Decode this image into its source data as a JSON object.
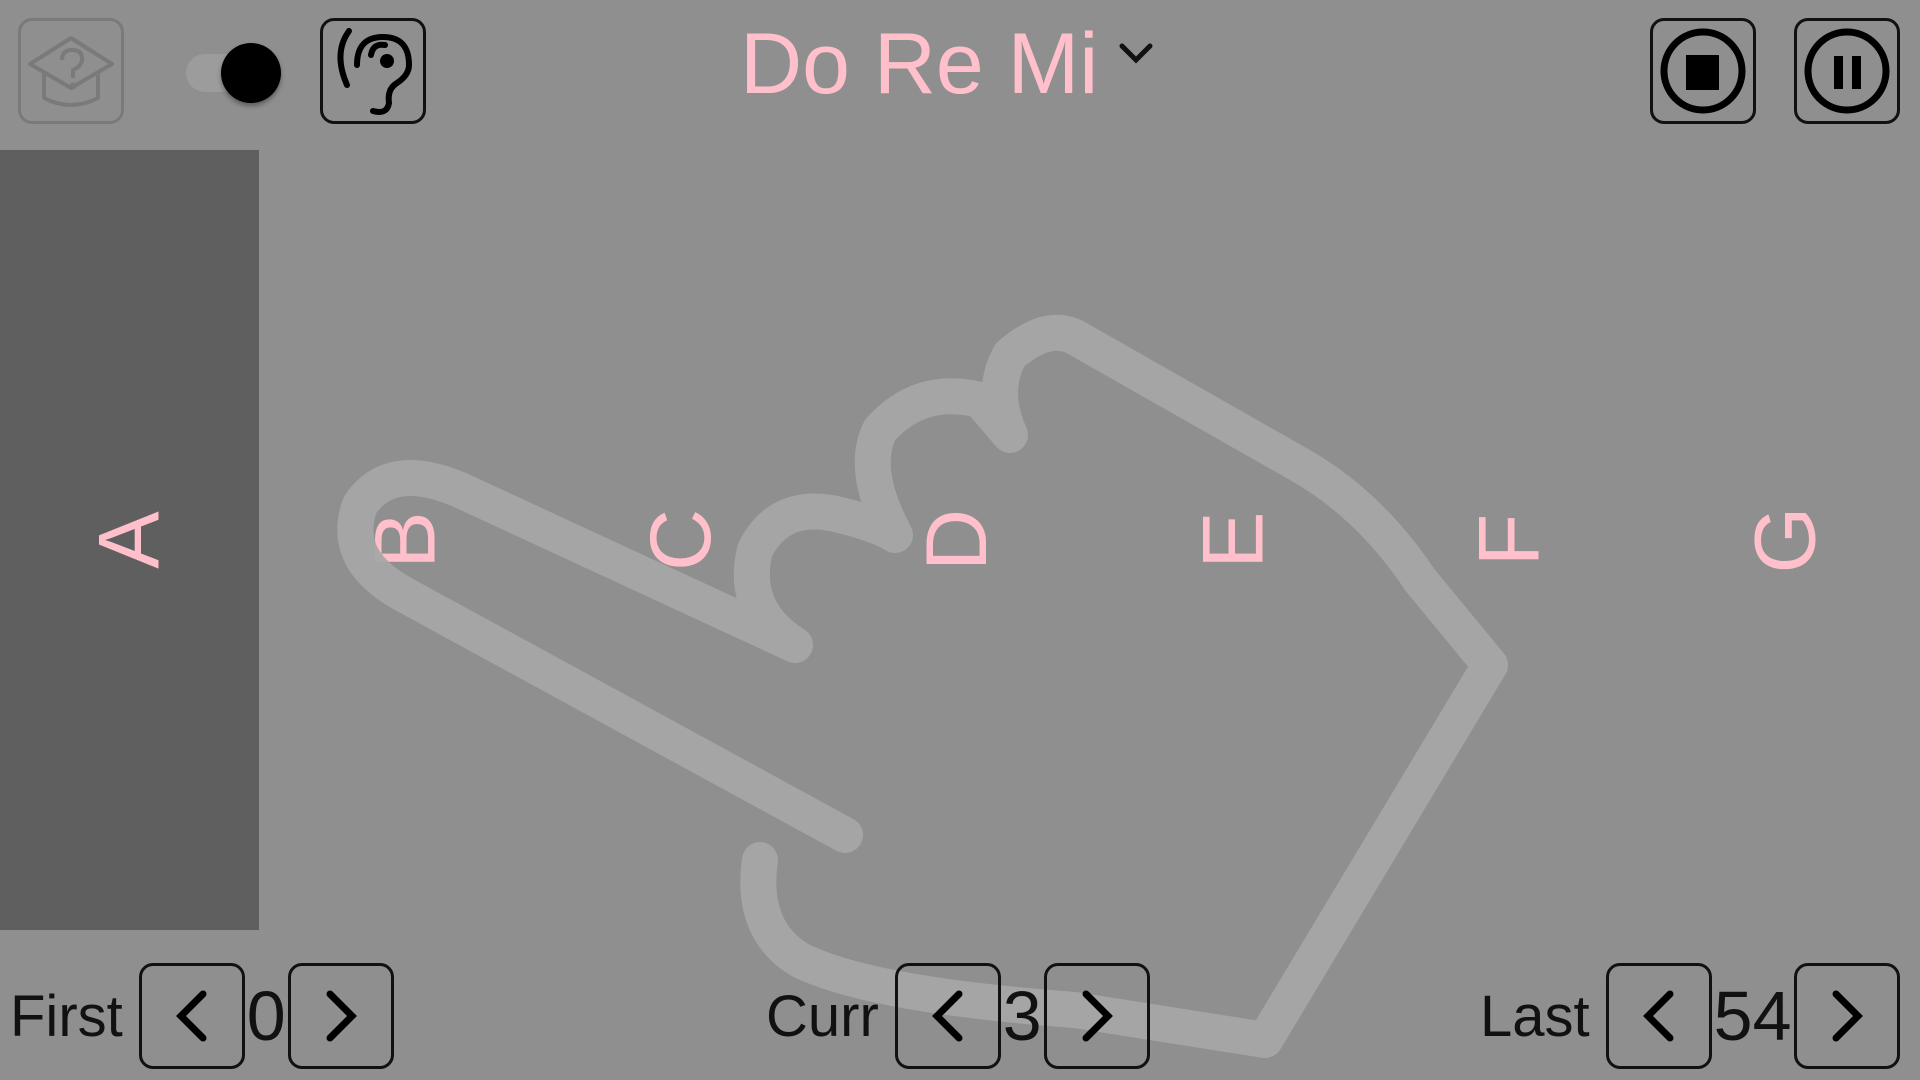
{
  "header": {
    "title": "Do Re Mi",
    "title_color": "#ffc0cb",
    "icons": {
      "help": "graduation-cap-question-icon",
      "toggle": "toggle-switch",
      "listen": "ear-icon",
      "stop": "stop-circle-icon",
      "pause": "pause-circle-icon",
      "dropdown": "chevron-down-icon"
    }
  },
  "keys": [
    {
      "label": "A",
      "active": true
    },
    {
      "label": "B",
      "active": false
    },
    {
      "label": "C",
      "active": false
    },
    {
      "label": "D",
      "active": false
    },
    {
      "label": "E",
      "active": false
    },
    {
      "label": "F",
      "active": false
    },
    {
      "label": "G",
      "active": false
    }
  ],
  "overlay": {
    "icon": "pointing-hand-icon"
  },
  "footer": {
    "first": {
      "label": "First",
      "value": "0"
    },
    "curr": {
      "label": "Curr",
      "value": "3"
    },
    "last": {
      "label": "Last",
      "value": "54"
    }
  },
  "colors": {
    "background": "#8f8f8f",
    "active_key": "#5f5f5f",
    "key_label": "#ffc0cb"
  }
}
